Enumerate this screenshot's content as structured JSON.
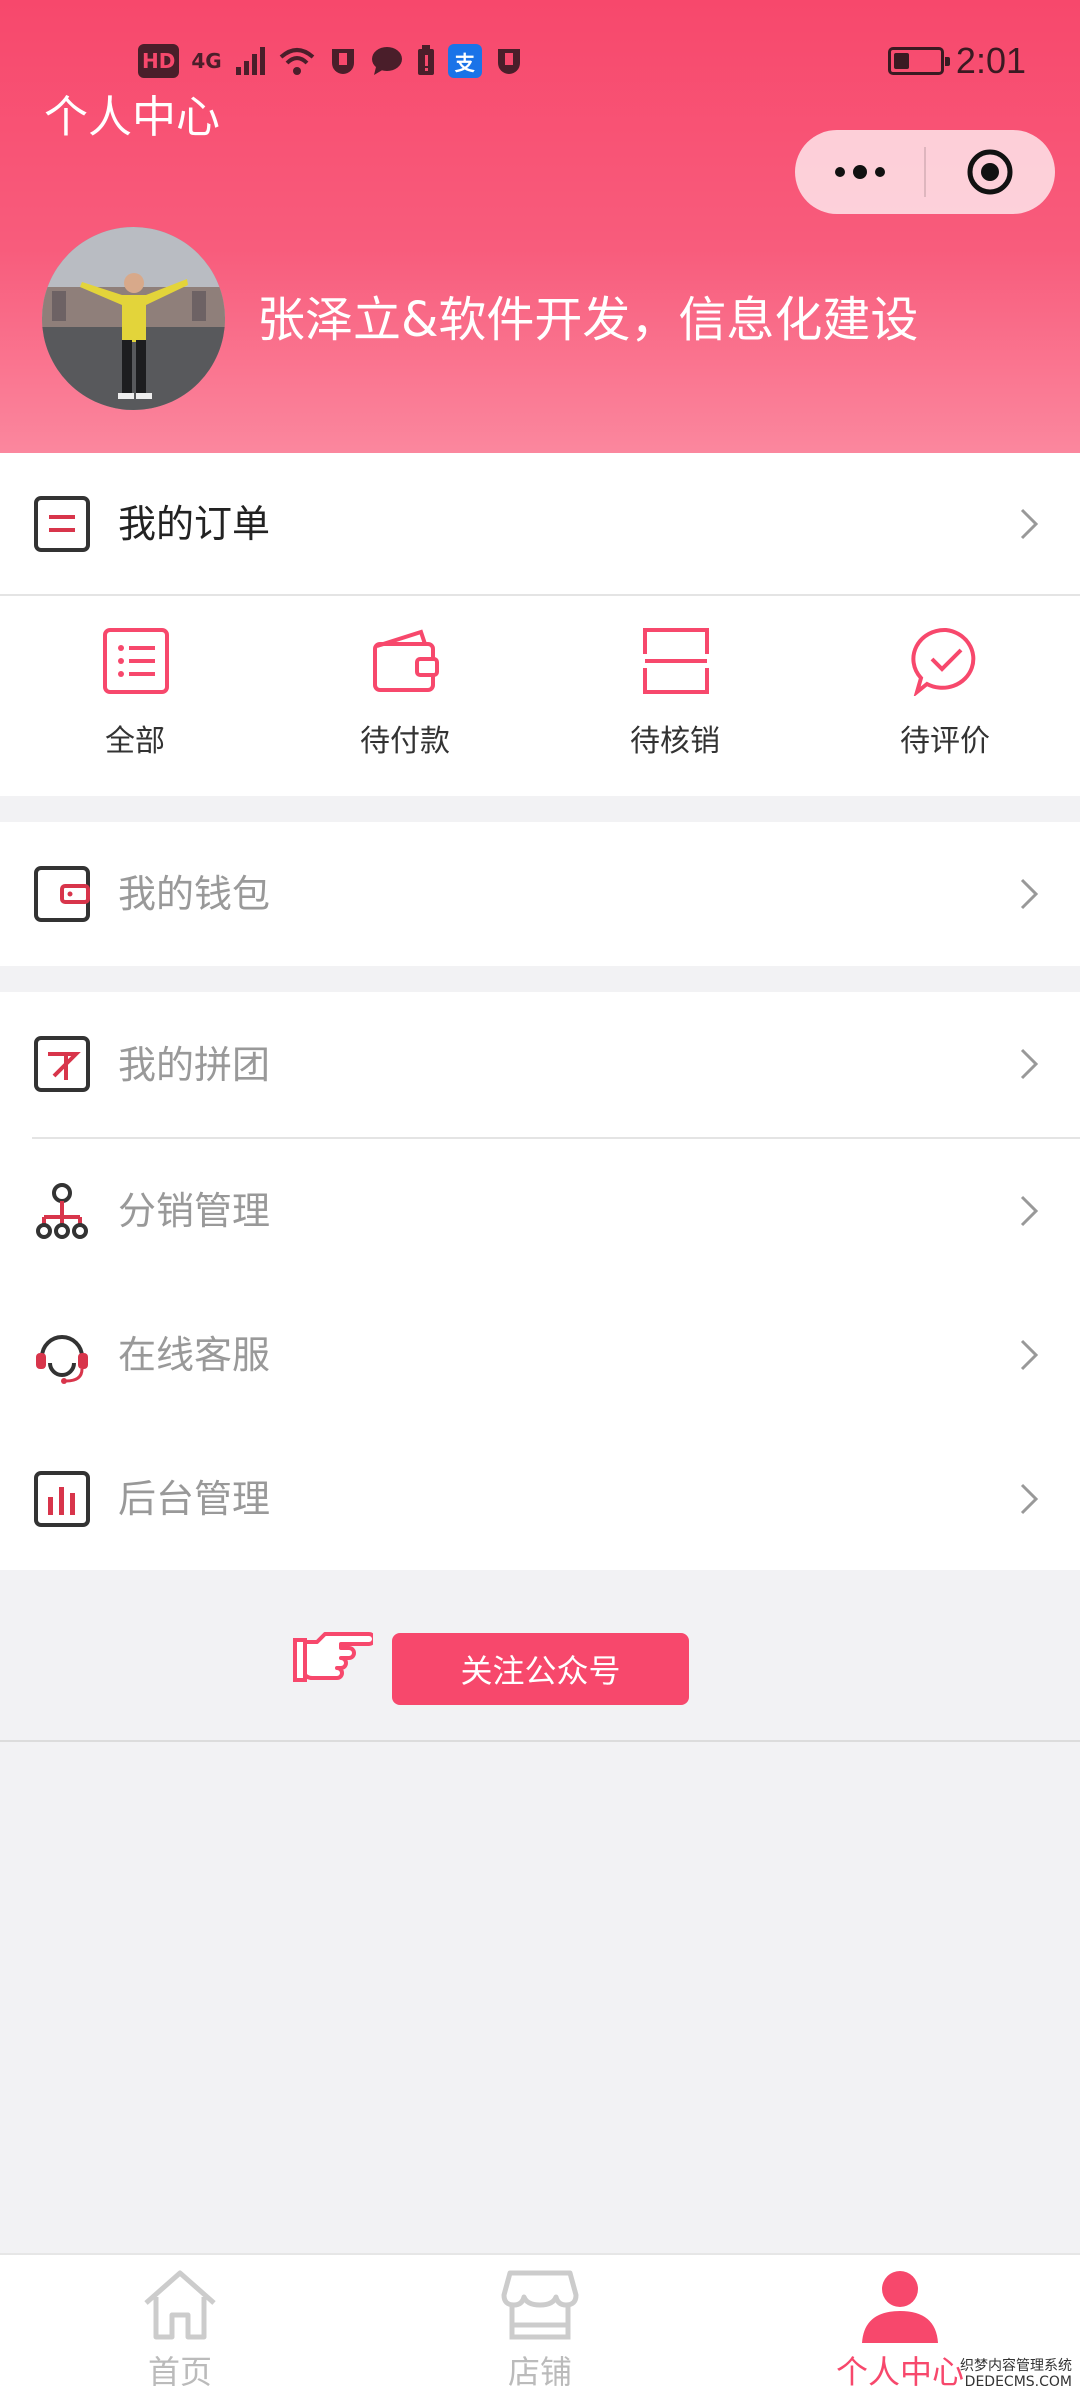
{
  "status_bar": {
    "hd": "HD",
    "network": "4G",
    "time": "2:01",
    "battery_percent": 35
  },
  "header": {
    "title": "个人中心",
    "nickname": "张泽立&软件开发，信息化建设",
    "accent_color": "#f7486c"
  },
  "orders": {
    "label": "我的订单",
    "items": [
      {
        "label": "全部",
        "icon": "list-icon"
      },
      {
        "label": "待付款",
        "icon": "wallet-icon"
      },
      {
        "label": "待核销",
        "icon": "scan-icon"
      },
      {
        "label": "待评价",
        "icon": "comment-check-icon"
      }
    ]
  },
  "menu": {
    "wallet": "我的钱包",
    "group_buy": "我的拼团",
    "distribution": "分销管理",
    "support": "在线客服",
    "admin": "后台管理"
  },
  "follow": {
    "button": "关注公众号"
  },
  "tabbar": {
    "items": [
      {
        "label": "首页",
        "icon": "home-icon"
      },
      {
        "label": "店铺",
        "icon": "store-icon"
      },
      {
        "label": "个人中心",
        "icon": "user-icon"
      }
    ],
    "active": 2
  },
  "watermark": {
    "line1": "织梦内容管理系统",
    "line2": "DEDECMS.COM"
  }
}
